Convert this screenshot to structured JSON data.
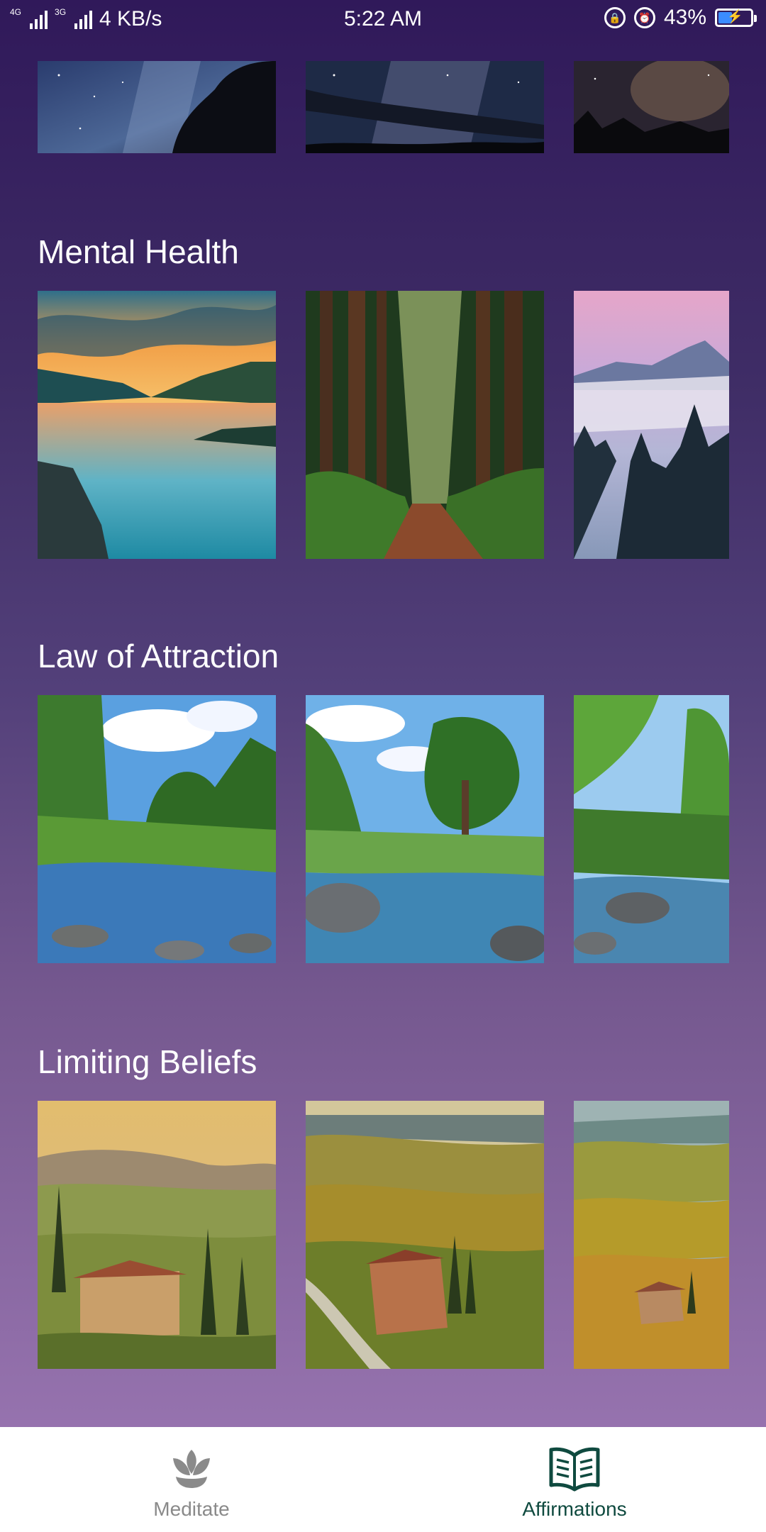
{
  "status_bar": {
    "network_1": "4G",
    "network_2": "3G",
    "speed": "4 KB/s",
    "time": "5:22 AM",
    "battery": "43%"
  },
  "sections": [
    {
      "title": "Mental Health"
    },
    {
      "title": "Law of Attraction"
    },
    {
      "title": "Limiting Beliefs"
    }
  ],
  "bottom_nav": {
    "items": [
      {
        "label": "Meditate",
        "icon": "lotus-icon",
        "active": false
      },
      {
        "label": "Affirmations",
        "icon": "open-book-icon",
        "active": true
      }
    ],
    "colors": {
      "active": "#0f4a3f",
      "inactive": "#8a8a8a"
    }
  },
  "colors": {
    "background_top": "#30195a",
    "background_bottom": "#9e79b6",
    "title_text": "#ffffff"
  }
}
